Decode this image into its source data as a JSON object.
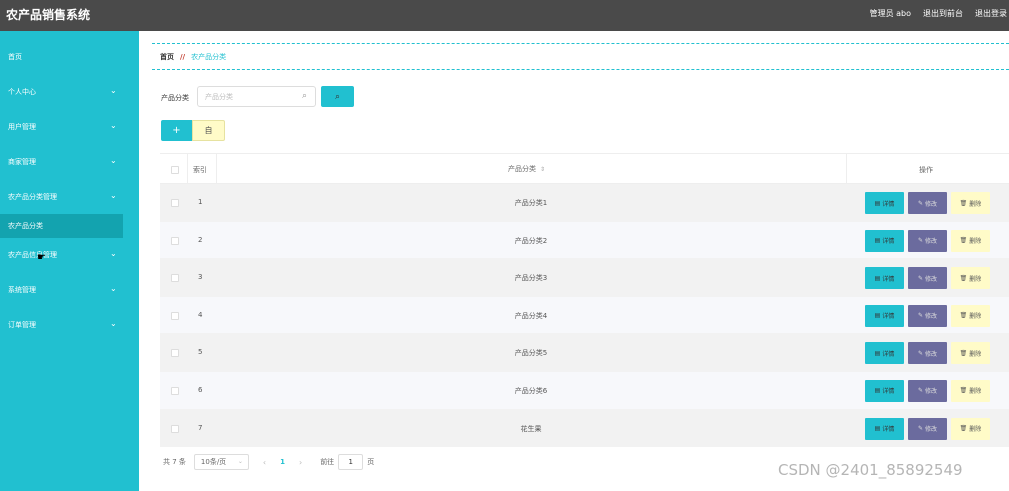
{
  "app": {
    "title": "农产品销售系统",
    "header_links": [
      "管理员 abo",
      "退出到前台",
      "退出登录"
    ]
  },
  "sidebar": {
    "items": [
      {
        "label": "首页",
        "chevron": false,
        "active": false
      },
      {
        "label": "个人中心",
        "chevron": true,
        "active": false
      },
      {
        "label": "用户管理",
        "chevron": true,
        "active": false
      },
      {
        "label": "商家管理",
        "chevron": true,
        "active": false
      },
      {
        "label": "农产品分类管理",
        "chevron": true,
        "active": false
      },
      {
        "label": "农产品分类",
        "chevron": false,
        "active": true
      },
      {
        "label": "农产品信息管理",
        "chevron": true,
        "active": false
      },
      {
        "label": "系统管理",
        "chevron": true,
        "active": false
      },
      {
        "label": "订单管理",
        "chevron": true,
        "active": false
      }
    ]
  },
  "breadcrumb": {
    "home": "首页",
    "separator": "//",
    "current": "农产品分类"
  },
  "search": {
    "label": "产品分类",
    "placeholder": "产品分类",
    "button_icon": "search-icon"
  },
  "actions": {
    "add_label": "+",
    "delete_label": "自"
  },
  "table": {
    "headers": {
      "index": "索引",
      "name": "产品分类",
      "ops": "操作"
    },
    "rows": [
      {
        "index": "1",
        "name": "产品分类1"
      },
      {
        "index": "2",
        "name": "产品分类2"
      },
      {
        "index": "3",
        "name": "产品分类3"
      },
      {
        "index": "4",
        "name": "产品分类4"
      },
      {
        "index": "5",
        "name": "产品分类5"
      },
      {
        "index": "6",
        "name": "产品分类6"
      },
      {
        "index": "7",
        "name": "花生果"
      }
    ],
    "op_labels": {
      "detail": "详情",
      "edit": "修改",
      "delete": "删除"
    }
  },
  "pagination": {
    "total": "共 7 条",
    "page_size": "10条/页",
    "current_page": "1",
    "goto_prefix": "前往",
    "goto_value": "1",
    "goto_suffix": "页"
  },
  "watermark": "CSDN @2401_85892549",
  "colors": {
    "accent": "#21c0d0",
    "topbar": "#4a4a4a",
    "edit_button": "#6b6b9e",
    "delete_button": "#fffbc8"
  }
}
